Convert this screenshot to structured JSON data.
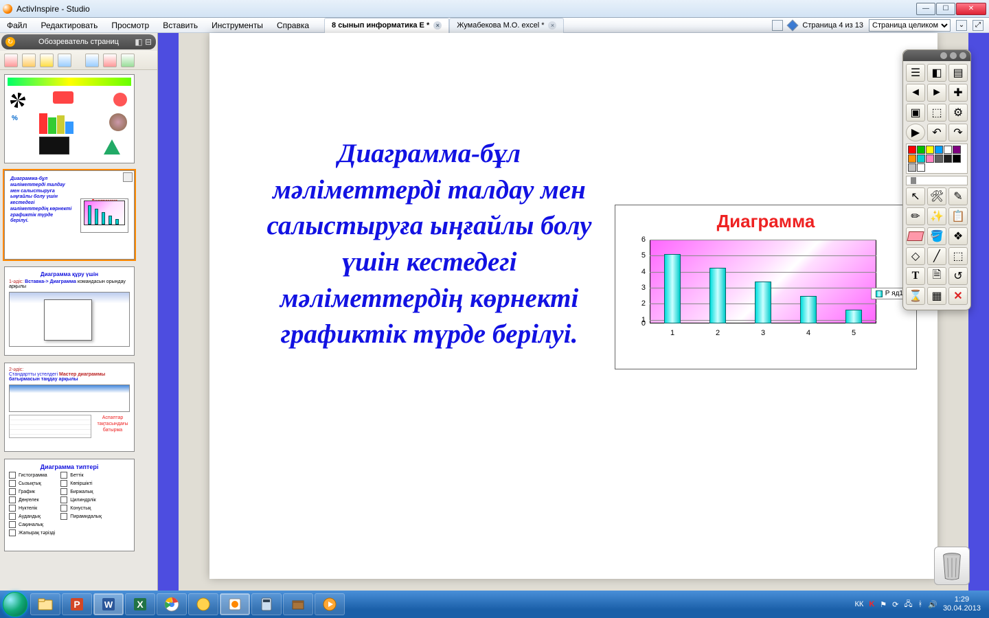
{
  "window": {
    "title": "ActivInspire - Studio"
  },
  "menus": [
    "Файл",
    "Редактировать",
    "Просмотр",
    "Вставить",
    "Инструменты",
    "Справка"
  ],
  "tabs": [
    {
      "label": "8 сынып информатика Е *",
      "active": true
    },
    {
      "label": "Жумабекова М.О. excel *",
      "active": false
    }
  ],
  "page_indicator": "Страница 4 из 13",
  "zoom_mode": "Страница целиком",
  "browser": {
    "title": "Обозреватель страниц",
    "thumb5_title": "Диаграмма типтері",
    "thumb5_left": [
      "Гистограмма",
      "Сызықтық",
      "График",
      "Дөңгелек",
      "Нүктелік",
      "Аудандық",
      "Сақиналық",
      "Жапырақ тәрізді"
    ],
    "thumb5_right": [
      "Беттік",
      "Көпіршікті",
      "Биржалық",
      "Цилиндрлік",
      "Конустық",
      "Пирамидалық"
    ],
    "thumb3_title": "Диаграмма құру үшін",
    "thumb3_l1a": "1-әдіс:",
    "thumb3_l1b": "Вставка-> Диаграмма",
    "thumb3_l1c": " командасын орындау арқылы",
    "thumb4_l1": "2-әдіс:",
    "thumb4_l2a": "Стандартты үстелдегі ",
    "thumb4_l2b": "Мастер диаграммы",
    "thumb4_l3": "батырмасын таңдау арқылы"
  },
  "slide": {
    "text": "Диаграмма-бұл мәліметтерді талдау мен салыстыруға ыңғайлы болу үшін кестедегі мәліметтердің көрнекті графиктік түрде берілуі.",
    "chart_title": "Диаграмма",
    "legend": "Р яд1"
  },
  "chart_data": {
    "type": "bar",
    "categories": [
      "1",
      "2",
      "3",
      "4",
      "5"
    ],
    "values": [
      5,
      4,
      3,
      2,
      1
    ],
    "title": "Диаграмма",
    "xlabel": "",
    "ylabel": "",
    "ylim": [
      0,
      6
    ],
    "yticks": [
      0,
      1,
      2,
      3,
      4,
      5,
      6
    ],
    "series": [
      {
        "name": "Р яд1",
        "values": [
          5,
          4,
          3,
          2,
          1
        ]
      }
    ]
  },
  "palette_colors": [
    "#ff0000",
    "#00c000",
    "#ffff00",
    "#00a0ff",
    "#ffffff",
    "#800080",
    "#ff9000",
    "#00d0d0",
    "#ff80c0",
    "#606060",
    "#202020",
    "#000000",
    "#c0c0c0",
    "#ffffff",
    "#ffffff",
    "#ffffff"
  ],
  "tray": {
    "lang": "КК",
    "time": "1:29",
    "date": "30.04.2013"
  }
}
